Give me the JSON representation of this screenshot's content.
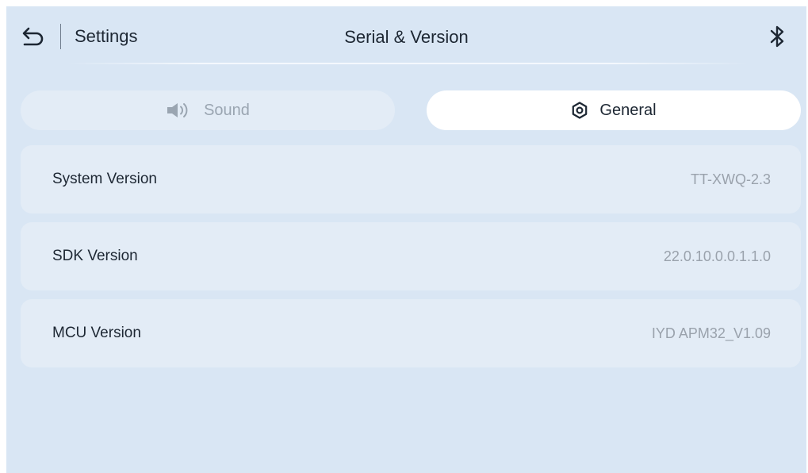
{
  "header": {
    "back_icon": "back-arrow-icon",
    "settings_label": "Settings",
    "title": "Serial & Version",
    "bluetooth_icon": "bluetooth-icon"
  },
  "tabs": [
    {
      "label": "Sound",
      "icon": "speaker-icon",
      "selected": false
    },
    {
      "label": "General",
      "icon": "gear-icon",
      "selected": true
    }
  ],
  "info_rows": [
    {
      "label": "System Version",
      "value": "TT-XWQ-2.3"
    },
    {
      "label": "SDK Version",
      "value": "22.0.10.0.0.1.1.0"
    },
    {
      "label": "MCU Version",
      "value": "IYD APM32_V1.09"
    }
  ],
  "colors": {
    "background": "#d9e6f4",
    "card": "#e3ecf6",
    "selected_tab": "#ffffff",
    "primary_text": "#1d2733",
    "muted_text": "#9aa2ac"
  }
}
